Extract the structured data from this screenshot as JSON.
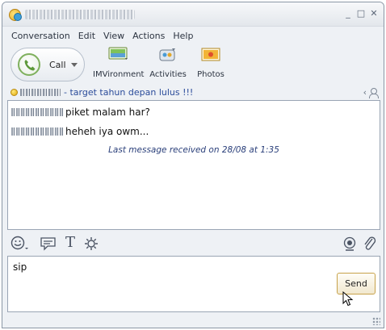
{
  "window": {
    "title": "",
    "controls": {
      "minimize": "_",
      "maximize": "□",
      "close": "✕"
    }
  },
  "menu": [
    "Conversation",
    "Edit",
    "View",
    "Actions",
    "Help"
  ],
  "toolbar": {
    "call_label": "Call",
    "tools": [
      {
        "label": "IMVironment",
        "icon": "imvironment-icon"
      },
      {
        "label": "Activities",
        "icon": "activities-icon"
      },
      {
        "label": "Photos",
        "icon": "photos-icon"
      }
    ]
  },
  "status": {
    "contact_name": "",
    "message": "- target tahun depan lulus !!!"
  },
  "chat": {
    "messages": [
      {
        "sender": "",
        "text": "piket malam har?"
      },
      {
        "sender": "",
        "text": "heheh iya owm..."
      }
    ],
    "last_received": "Last message received on 28/08 at 1:35"
  },
  "compose": {
    "text": "sip",
    "send_label": "Send"
  },
  "colors": {
    "status_message": "#2a4b9a",
    "send_border": "#c7a24a",
    "call_ring": "#7fb05d"
  }
}
